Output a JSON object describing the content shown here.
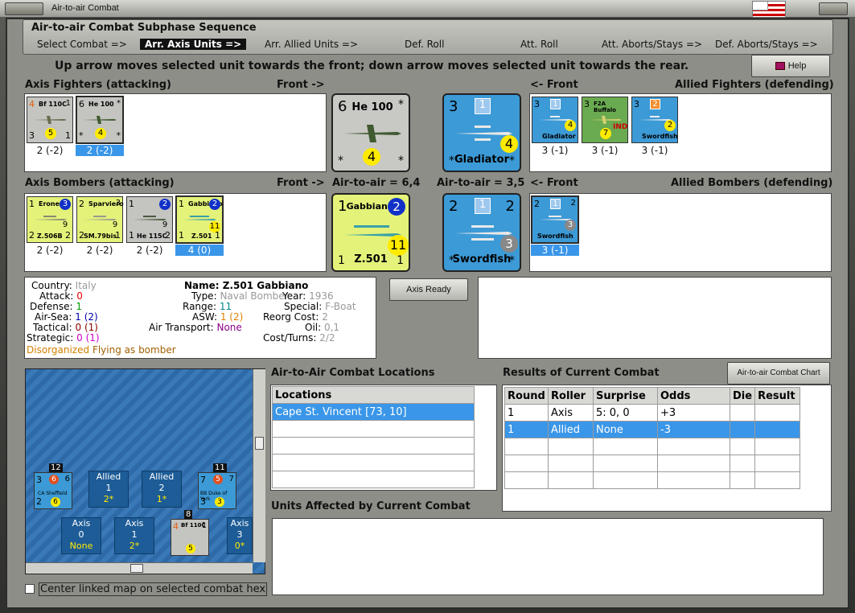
{
  "window": {
    "title": "Air-to-air Combat"
  },
  "subphase": {
    "header": "Air-to-air Combat Subphase Sequence",
    "steps": [
      "Select Combat =>",
      "Arr. Axis Units =>",
      "Arr. Allied Units =>",
      "Def. Roll",
      "Att. Roll",
      "Att. Aborts/Stays =>",
      "Def. Aborts/Stays =>"
    ],
    "active_index": 1
  },
  "instruction": "Up arrow moves selected unit towards the front; down arrow moves selected unit towards the rear.",
  "help_label": "Help",
  "labels": {
    "axis_fighters": "Axis Fighters (attacking)",
    "front_right": "Front ->",
    "front_left": "<- Front",
    "allied_fighters": "Allied Fighters (defending)",
    "axis_bombers": "Axis Bombers (attacking)",
    "air_to_air_axis": "Air-to-air = 6,4",
    "air_to_air_allied": "Air-to-air = 3,5",
    "allied_bombers": "Allied Bombers (defending)"
  },
  "axis_fighters": [
    {
      "name": "Bf 110C",
      "tl": "4",
      "tr": "1",
      "bl": "3",
      "br": "1",
      "y": "5",
      "circle": "1",
      "value": "2 (-2)",
      "selected": false
    },
    {
      "name": "He 100",
      "tl": "6",
      "tr": "*",
      "bl": "*",
      "br": "*",
      "y": "4",
      "circle": "",
      "value": "2 (-2)",
      "selected": true
    }
  ],
  "axis_bombers": [
    {
      "name": "Erone",
      "sub": "Z.506B",
      "tl": "1",
      "tr": "3",
      "bl": "2",
      "br": "2",
      "y": "9",
      "value": "2 (-2)",
      "selected": false
    },
    {
      "name": "Sparviero",
      "sub": "SM.79bis",
      "tl": "2",
      "tr": "3",
      "bl": "2",
      "br": "1",
      "y": "9",
      "value": "2 (-2)",
      "selected": false
    },
    {
      "name": "",
      "sub": "He 115C",
      "tl": "1",
      "tr": "2",
      "bl": "1",
      "br": "2",
      "y": "9",
      "value": "2 (-2)",
      "selected": false
    },
    {
      "name": "Gabbiano",
      "sub": "Z.501",
      "tl": "1",
      "tr": "2",
      "bl": "1",
      "br": "1",
      "y": "11",
      "value": "4 (0)",
      "selected": true
    }
  ],
  "allied_fighters": [
    {
      "name": "Gladiator",
      "tl": "3",
      "sq": "1",
      "y": "4",
      "value": "3 (-1)"
    },
    {
      "name": "F2A Buffalo",
      "tl": "3",
      "sq": "",
      "y": "7",
      "value": "3 (-1)",
      "tag": "IND"
    },
    {
      "name": "Swordfish",
      "tl": "3",
      "sq": "2",
      "y": "2",
      "value": "3 (-1)"
    }
  ],
  "allied_bombers": [
    {
      "name": "Swordfish",
      "tl": "2",
      "tr": "2",
      "sq": "1",
      "g": "3",
      "value": "3 (-1)",
      "selected": true
    }
  ],
  "big_axis_fighter": {
    "tl": "6",
    "name": "He 100",
    "tr": "*",
    "y": "4",
    "bl": "*",
    "br": "*"
  },
  "big_allied_fighter": {
    "tl": "3",
    "sq": "1",
    "y": "4",
    "name": "Gladiator",
    "bl": "*",
    "br": "*"
  },
  "big_axis_bomber": {
    "tl": "1",
    "name": "Gabbiano",
    "circle": "2",
    "y": "11",
    "sub": "Z.501",
    "bl": "1",
    "br": "1"
  },
  "big_allied_bomber": {
    "tl": "2",
    "sq": "1",
    "tr": "2",
    "g": "3",
    "sub": "Swordfish",
    "bl": "*",
    "br": "*"
  },
  "unit_info": {
    "country_label": "Country:",
    "country": "Italy",
    "attack_label": "Attack:",
    "attack": "0",
    "defense_label": "Defense:",
    "defense": "1",
    "airsea_label": "Air-Sea:",
    "airsea": "1 (2)",
    "tactical_label": "Tactical:",
    "tactical": "0 (1)",
    "strategic_label": "Strategic:",
    "strategic": "0 (1)",
    "status1": "Disorganized",
    "status2": "Flying as bomber",
    "name_label": "Name:",
    "name": "Z.501 Gabbiano",
    "type_label": "Type:",
    "type": "Naval Bomber",
    "year_label": "Year:",
    "year": "1936",
    "range_label": "Range:",
    "range": "11",
    "special_label": "Special:",
    "special": "F-Boat",
    "asw_label": "ASW:",
    "asw": "1 (2)",
    "reorg_label": "Reorg Cost:",
    "reorg": "2",
    "transport_label": "Air Transport:",
    "transport": "None",
    "oil_label": "Oil:",
    "oil": "0,1",
    "cost_label": "Cost/Turns:",
    "cost": "2/2"
  },
  "axis_ready_label": "Axis Ready",
  "combat_chart_label": "Air-to-air Combat Chart",
  "locations": {
    "title": "Air-to-Air Combat Locations",
    "header": "Locations",
    "rows": [
      "Cape St. Vincent [73, 10]"
    ]
  },
  "results": {
    "title": "Results of Current Combat",
    "headers": [
      "Round",
      "Roller",
      "Surprise",
      "Odds",
      "Die",
      "Result"
    ],
    "rows": [
      [
        "1",
        "Axis",
        "5: 0, 0",
        "+3",
        "",
        ""
      ],
      [
        "1",
        "Allied",
        "None",
        "-3",
        "",
        ""
      ]
    ]
  },
  "units_affected_title": "Units Affected by Current Combat",
  "center_checkbox_label": "Center linked map on selected combat hex",
  "map": {
    "ship1": {
      "top": "12",
      "tl": "3",
      "c": "6",
      "tr": "6",
      "name": "CA Sheffield",
      "bl": "2",
      "y": "6"
    },
    "ship2": {
      "top": "11",
      "tl": "7",
      "c": "5",
      "tr": "7",
      "name": "BB Duke of York",
      "bl": "3",
      "y": "3"
    },
    "allied1": {
      "l1": "Allied",
      "l2": "1",
      "l3": "2*"
    },
    "allied2": {
      "l1": "Allied",
      "l2": "2",
      "l3": "1*"
    },
    "axis0": {
      "l1": "Axis",
      "l2": "0",
      "l3": "None"
    },
    "axis1": {
      "l1": "Axis",
      "l2": "1",
      "l3": "2*"
    },
    "axis3": {
      "l1": "Axis",
      "l2": "3",
      "l3": "0*"
    },
    "plane": {
      "top": "8",
      "tl": "4",
      "name": "Bf 110C",
      "tr": "1",
      "y": "5"
    }
  },
  "colors": {
    "selection": "#3a96e8",
    "allied_counter": "#3c9ad6",
    "axis_bomber_counter": "#e4f27a",
    "axis_fighter_counter": "#c4c4c0"
  }
}
